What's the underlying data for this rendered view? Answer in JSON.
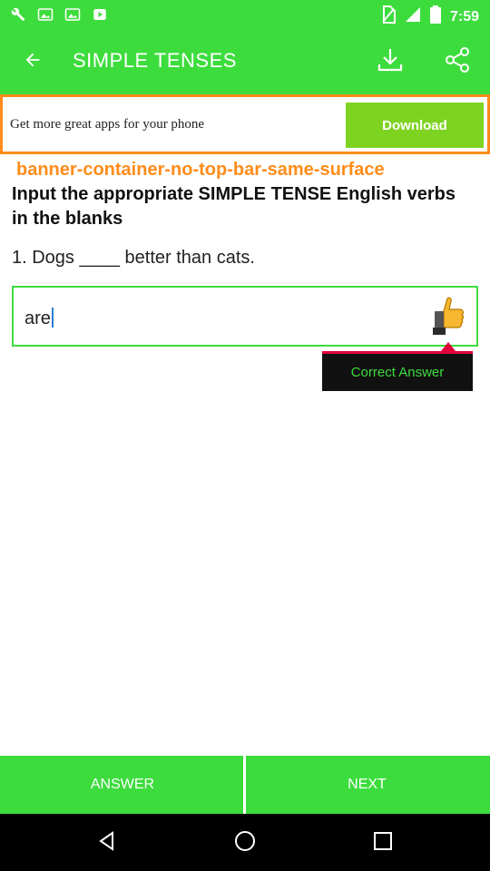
{
  "status": {
    "time": "7:59"
  },
  "app_bar": {
    "title": "SIMPLE TENSES"
  },
  "banner": {
    "text": "Get more great apps for your phone",
    "button": "Download"
  },
  "banner_label": "banner-container-no-top-bar-same-surface",
  "quiz": {
    "instructions": "Input the appropriate SIMPLE TENSE English verbs in the blanks",
    "question": "1. Dogs ____ better than cats.",
    "answer_value": "are"
  },
  "tooltip": {
    "text": "Correct Answer"
  },
  "bottom": {
    "answer_label": "ANSWER",
    "next_label": "NEXT"
  },
  "colors": {
    "accent": "#3ddc3d",
    "banner_border": "#ff8c1a",
    "download": "#7ed321",
    "tooltip_bar": "#e0003c"
  },
  "icons": [
    "back-arrow-icon",
    "download-icon",
    "share-icon",
    "thumbs-up-icon",
    "nav-back-icon",
    "nav-home-icon",
    "nav-recents-icon"
  ]
}
